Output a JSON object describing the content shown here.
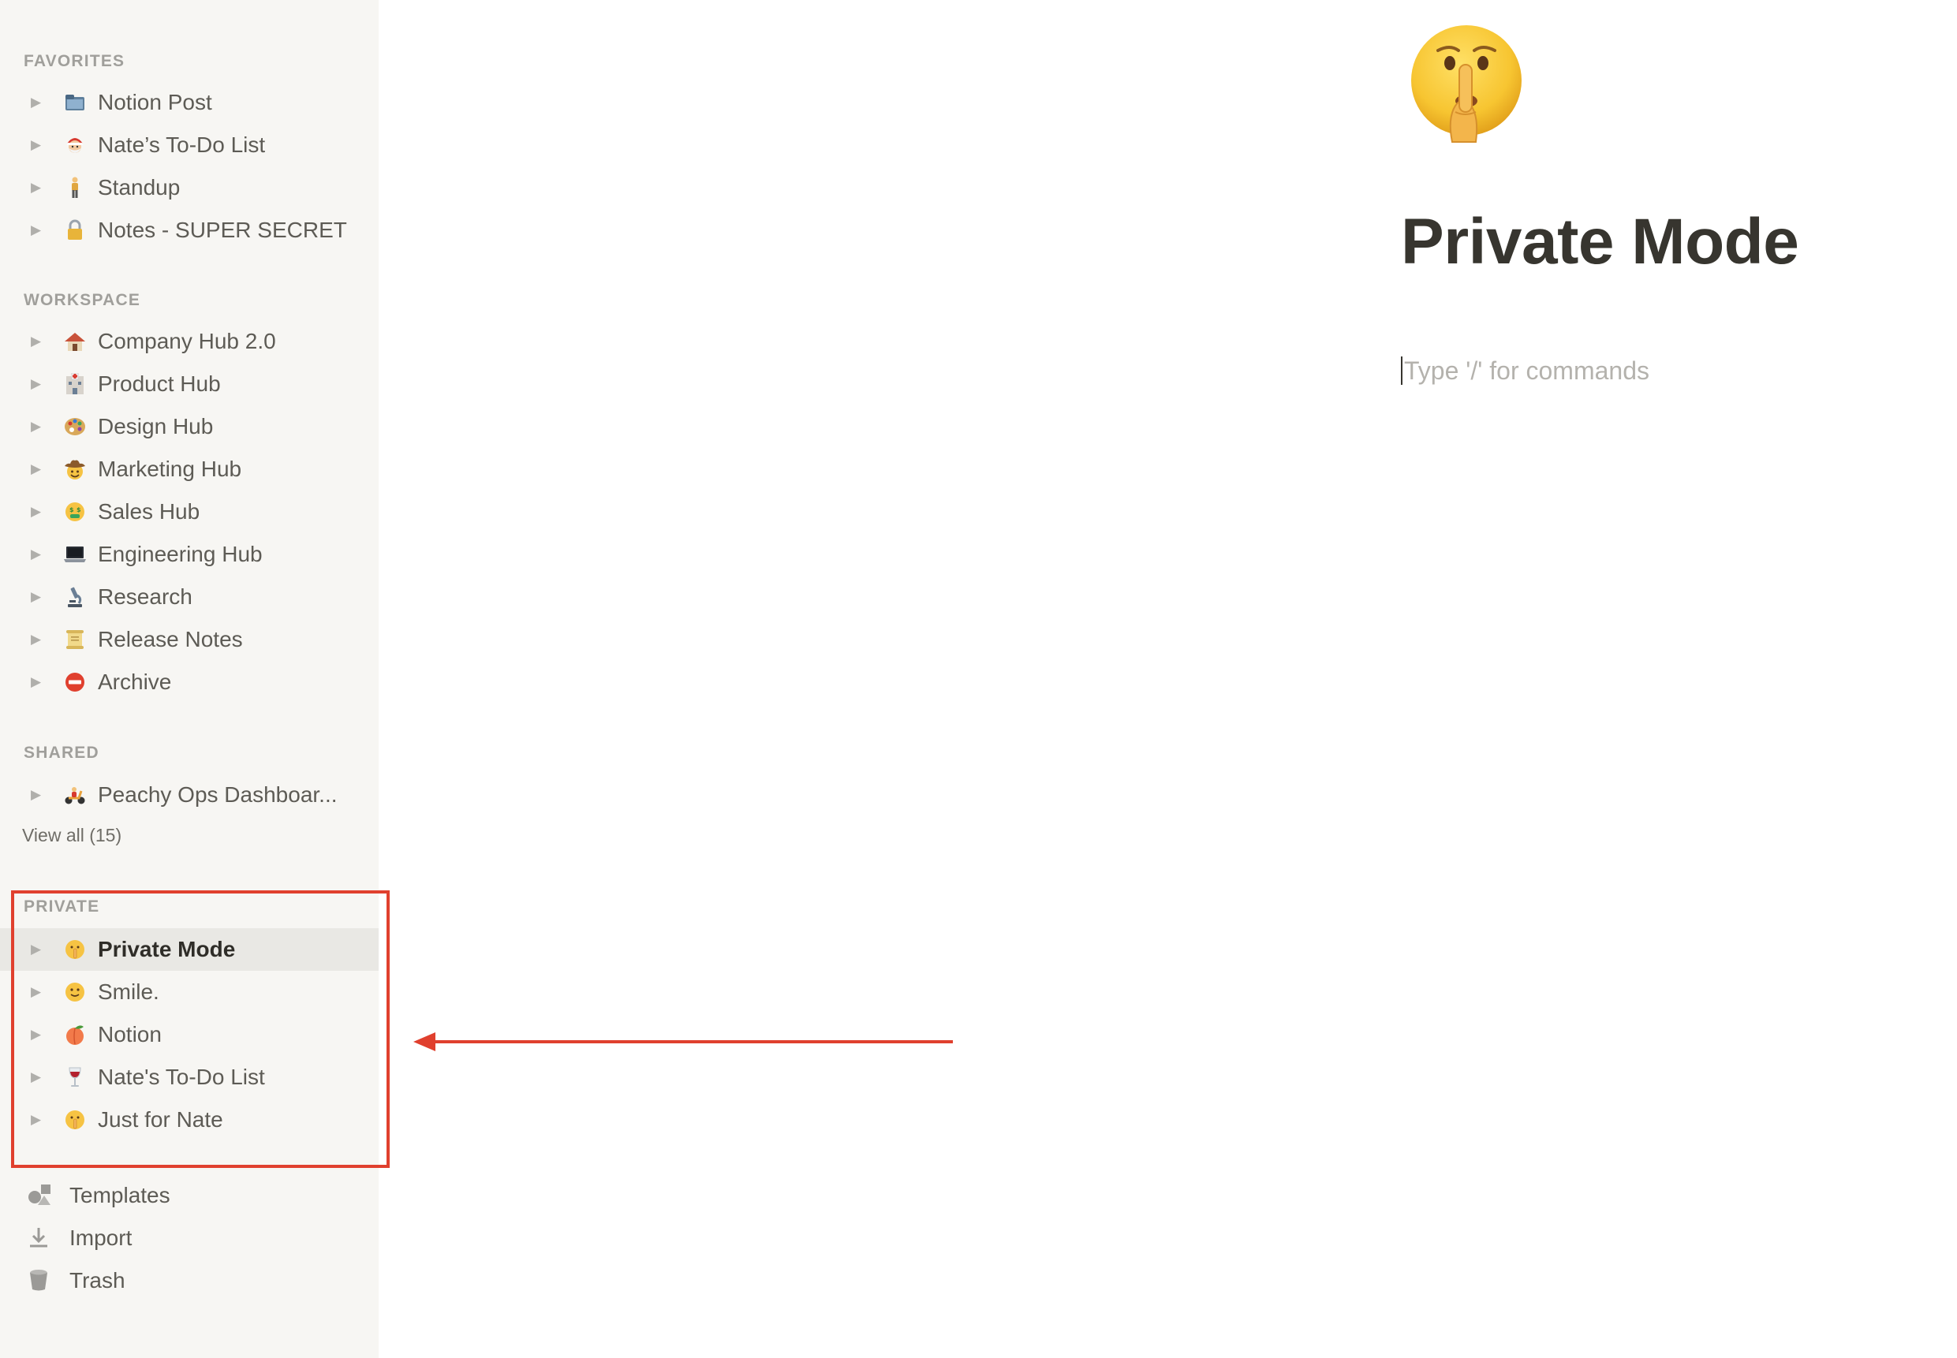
{
  "sidebar": {
    "favorites": {
      "title": "FAVORITES",
      "items": [
        {
          "label": "Notion Post",
          "icon": "folder-icon"
        },
        {
          "label": "Nate’s To-Do List",
          "icon": "santa-icon"
        },
        {
          "label": "Standup",
          "icon": "standing-person-icon"
        },
        {
          "label": "Notes - SUPER SECRET",
          "icon": "lock-icon"
        }
      ]
    },
    "workspace": {
      "title": "WORKSPACE",
      "items": [
        {
          "label": "Company Hub 2.0",
          "icon": "house-icon"
        },
        {
          "label": "Product Hub",
          "icon": "hospital-icon"
        },
        {
          "label": "Design Hub",
          "icon": "palette-icon"
        },
        {
          "label": "Marketing Hub",
          "icon": "cowboy-face-icon"
        },
        {
          "label": "Sales Hub",
          "icon": "money-mouth-face-icon"
        },
        {
          "label": "Engineering Hub",
          "icon": "laptop-icon"
        },
        {
          "label": "Research",
          "icon": "microscope-icon"
        },
        {
          "label": "Release Notes",
          "icon": "scroll-icon"
        },
        {
          "label": "Archive",
          "icon": "no-entry-icon"
        }
      ]
    },
    "shared": {
      "title": "SHARED",
      "items": [
        {
          "label": "Peachy Ops Dashboar...",
          "icon": "scooter-icon"
        }
      ],
      "view_all": "View all (15)"
    },
    "private": {
      "title": "PRIVATE",
      "items": [
        {
          "label": "Private Mode",
          "icon": "shushing-face-icon",
          "active": true
        },
        {
          "label": "Smile.",
          "icon": "slightly-smiling-face-icon"
        },
        {
          "label": "Notion",
          "icon": "peach-icon"
        },
        {
          "label": "Nate's To-Do List",
          "icon": "wine-glass-icon"
        },
        {
          "label": "Just for Nate",
          "icon": "shushing-face-icon"
        }
      ]
    },
    "utilities": [
      {
        "label": "Templates",
        "icon": "shapes-icon"
      },
      {
        "label": "Import",
        "icon": "download-icon"
      },
      {
        "label": "Trash",
        "icon": "trash-icon"
      }
    ]
  },
  "page": {
    "icon": "shushing-face-icon",
    "title": "Private Mode",
    "editor_placeholder": "Type '/' for commands"
  },
  "annotation": {
    "highlight_color": "#e0402e",
    "arrow_color": "#e0402e"
  }
}
